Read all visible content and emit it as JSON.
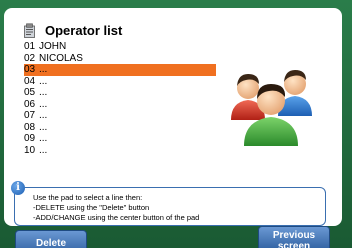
{
  "header": {
    "title": "Operator list"
  },
  "operators": [
    {
      "num": "01",
      "name": "JOHN",
      "selected": false
    },
    {
      "num": "02",
      "name": "NICOLAS",
      "selected": false
    },
    {
      "num": "03",
      "name": "...",
      "selected": true
    },
    {
      "num": "04",
      "name": "...",
      "selected": false
    },
    {
      "num": "05",
      "name": "...",
      "selected": false
    },
    {
      "num": "06",
      "name": "...",
      "selected": false
    },
    {
      "num": "07",
      "name": "...",
      "selected": false
    },
    {
      "num": "08",
      "name": "...",
      "selected": false
    },
    {
      "num": "09",
      "name": "...",
      "selected": false
    },
    {
      "num": "10",
      "name": "...",
      "selected": false
    }
  ],
  "info": {
    "lines": [
      "Use the pad to select a line then:",
      "-DELETE using the \"Delete\" button",
      "-ADD/CHANGE using the center button of the pad"
    ],
    "icon": "info-icon"
  },
  "buttons": {
    "delete_label": "Delete",
    "previous_label_1": "Previous",
    "previous_label_2": "screen"
  },
  "colors": {
    "selection": "#f07020",
    "accent": "#2e5f9f",
    "background": "#1f6a3c"
  }
}
